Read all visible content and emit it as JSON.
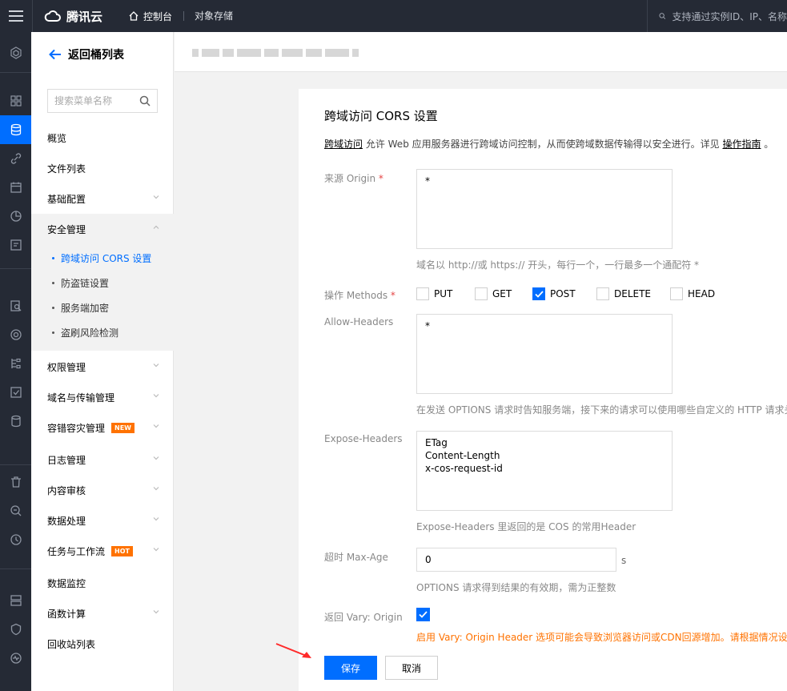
{
  "topbar": {
    "logo_text": "腾讯云",
    "console_label": "控制台",
    "product_label": "对象存储",
    "search_placeholder": "支持通过实例ID、IP、名称"
  },
  "rail": {
    "icons": [
      "cube-icon",
      "dashboard-icon",
      "storage-icon",
      "link-icon",
      "calendar-icon",
      "chart-icon",
      "report-icon",
      "search-doc-icon",
      "target-icon",
      "network-icon",
      "check-icon",
      "database-icon",
      "trash-icon",
      "scan-icon",
      "clock-icon",
      "storage-db-icon",
      "shield-icon",
      "monitor-icon"
    ],
    "active": "storage-icon"
  },
  "sidebar": {
    "back_label": "返回桶列表",
    "search_placeholder": "搜索菜单名称",
    "items": [
      {
        "label": "概览"
      },
      {
        "label": "文件列表"
      },
      {
        "label": "基础配置"
      },
      {
        "label": "安全管理"
      },
      {
        "label": "权限管理"
      },
      {
        "label": "域名与传输管理"
      },
      {
        "label": "容错容灾管理",
        "badge": "NEW"
      },
      {
        "label": "日志管理"
      },
      {
        "label": "内容审核"
      },
      {
        "label": "数据处理"
      },
      {
        "label": "任务与工作流",
        "badge": "HOT"
      },
      {
        "label": "数据监控"
      },
      {
        "label": "函数计算"
      },
      {
        "label": "回收站列表"
      }
    ],
    "security_subitems": [
      {
        "label": "跨域访问 CORS 设置"
      },
      {
        "label": "防盗链设置"
      },
      {
        "label": "服务端加密"
      },
      {
        "label": "盗刷风险检测"
      }
    ]
  },
  "panel": {
    "title": "跨域访问 CORS 设置",
    "desc_link": "跨域访问",
    "desc_text": " 允许 Web 应用服务器进行跨域访问控制，从而使跨域数据传输得以安全进行。详见 ",
    "desc_guide": "操作指南",
    "desc_end": " 。",
    "origin": {
      "label": "来源 Origin",
      "required": "*",
      "value": "*",
      "hint": "域名以 http://或 https:// 开头，每行一个，一行最多一个通配符 *"
    },
    "methods": {
      "label": "操作 Methods",
      "required": "*",
      "options": [
        {
          "label": "PUT",
          "checked": false
        },
        {
          "label": "GET",
          "checked": false
        },
        {
          "label": "POST",
          "checked": true
        },
        {
          "label": "DELETE",
          "checked": false
        },
        {
          "label": "HEAD",
          "checked": false
        }
      ]
    },
    "allow_headers": {
      "label": "Allow-Headers",
      "value": "*",
      "hint": "在发送 OPTIONS 请求时告知服务端，接下来的请求可以使用哪些自定义的 HTTP 请求头"
    },
    "expose_headers": {
      "label": "Expose-Headers",
      "value": "ETag\nContent-Length\nx-cos-request-id",
      "hint": "Expose-Headers 里返回的是 COS 的常用Header"
    },
    "max_age": {
      "label": "超时 Max-Age",
      "value": "0",
      "unit": "s",
      "hint": "OPTIONS 请求得到结果的有效期，需为正整数"
    },
    "vary": {
      "label": "返回 Vary: Origin",
      "checked": true,
      "hint": "启用 Vary: Origin Header 选项可能会导致浏览器访问或CDN回源增加。请根据情况设置"
    },
    "save_label": "保存",
    "cancel_label": "取消"
  },
  "colors": {
    "primary": "#006eff",
    "topbar": "#252a35",
    "warning": "#ff7200",
    "required": "#e54545"
  }
}
